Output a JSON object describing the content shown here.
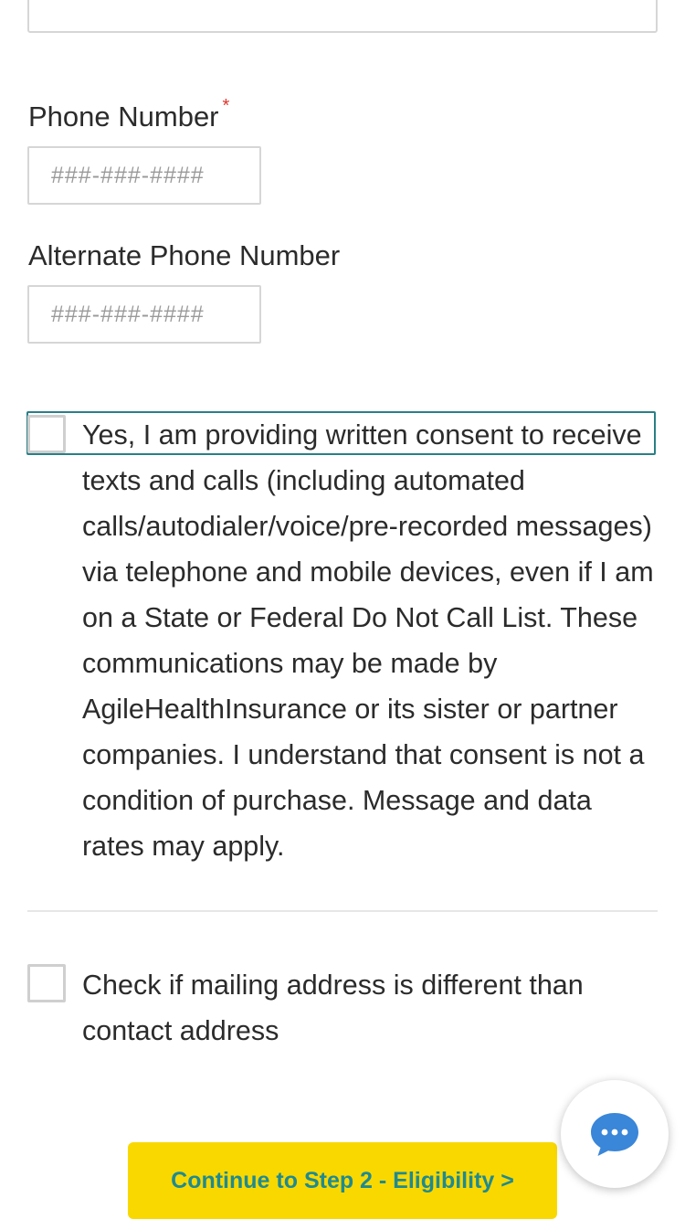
{
  "form": {
    "phone": {
      "label": "Phone Number",
      "required_mark": "*",
      "placeholder": "###-###-####"
    },
    "alternate_phone": {
      "label": "Alternate Phone Number",
      "placeholder": "###-###-####"
    },
    "consent": {
      "checked": false,
      "text": "Yes, I am providing written consent to receive texts and calls (including automated calls/autodialer/voice/pre-recorded messages) via telephone and mobile devices, even if I am on a State or Federal Do Not Call List. These communications may be made by AgileHealthInsurance or its sister or partner companies. I understand that consent is not a condition of purchase. Message and data rates may apply."
    },
    "mailing_address": {
      "checked": false,
      "text": "Check if mailing address is different than contact address"
    }
  },
  "actions": {
    "continue_label": "Continue to Step 2 - Eligibility >"
  },
  "chat": {
    "icon": "chat-bubble-icon",
    "color": "#3a86d8"
  },
  "colors": {
    "button_bg": "#f9d800",
    "button_text": "#1f8a8f",
    "focus_outline": "#2a7f86",
    "required_star": "#e0352b"
  }
}
